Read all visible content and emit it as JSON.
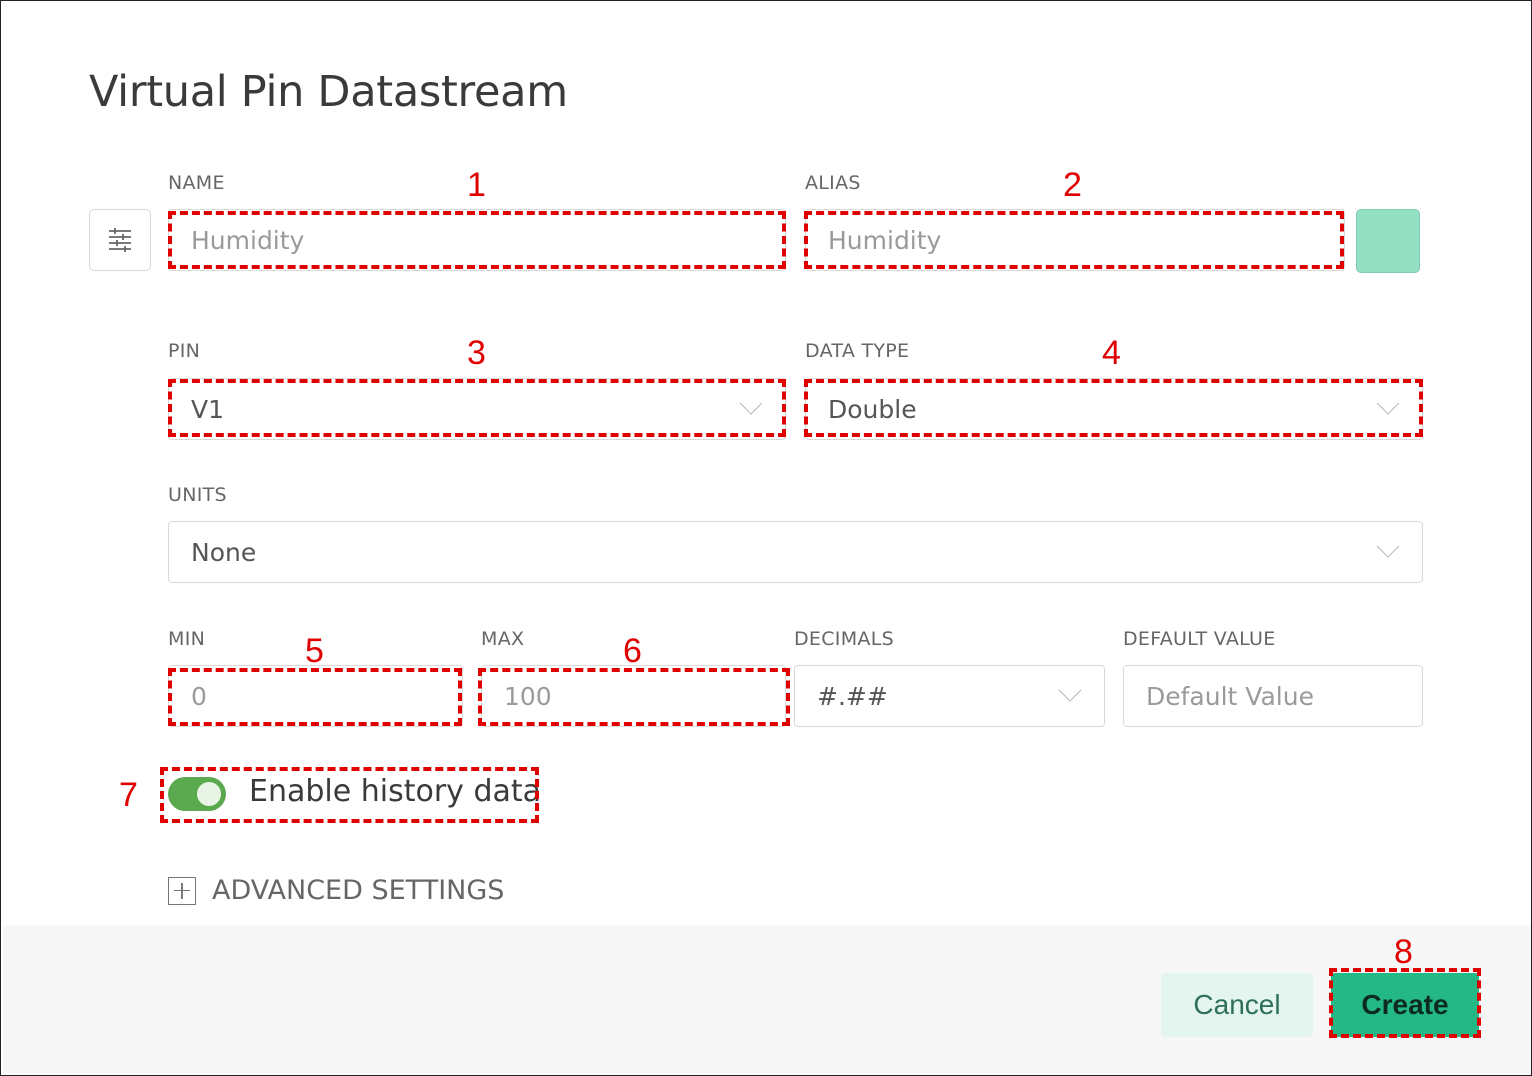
{
  "dialog": {
    "title": "Virtual Pin Datastream"
  },
  "fields": {
    "name": {
      "label": "NAME",
      "value": "Humidity"
    },
    "alias": {
      "label": "ALIAS",
      "value": "Humidity"
    },
    "pin": {
      "label": "PIN",
      "value": "V1"
    },
    "data_type": {
      "label": "DATA TYPE",
      "value": "Double"
    },
    "units": {
      "label": "UNITS",
      "value": "None"
    },
    "min": {
      "label": "MIN",
      "value": "0"
    },
    "max": {
      "label": "MAX",
      "value": "100"
    },
    "decimals": {
      "label": "DECIMALS",
      "value": "#.##"
    },
    "default_value": {
      "label": "DEFAULT VALUE",
      "placeholder": "Default Value"
    }
  },
  "color_swatch": {
    "color": "#93e0c4"
  },
  "history": {
    "label": "Enable history data",
    "enabled": true
  },
  "advanced": {
    "label": "ADVANCED SETTINGS"
  },
  "buttons": {
    "cancel": "Cancel",
    "create": "Create"
  },
  "annotations": [
    "1",
    "2",
    "3",
    "4",
    "5",
    "6",
    "7",
    "8"
  ],
  "colors": {
    "accent": "#23b886",
    "toggle": "#5aa94f",
    "annotation": "#e00000"
  }
}
